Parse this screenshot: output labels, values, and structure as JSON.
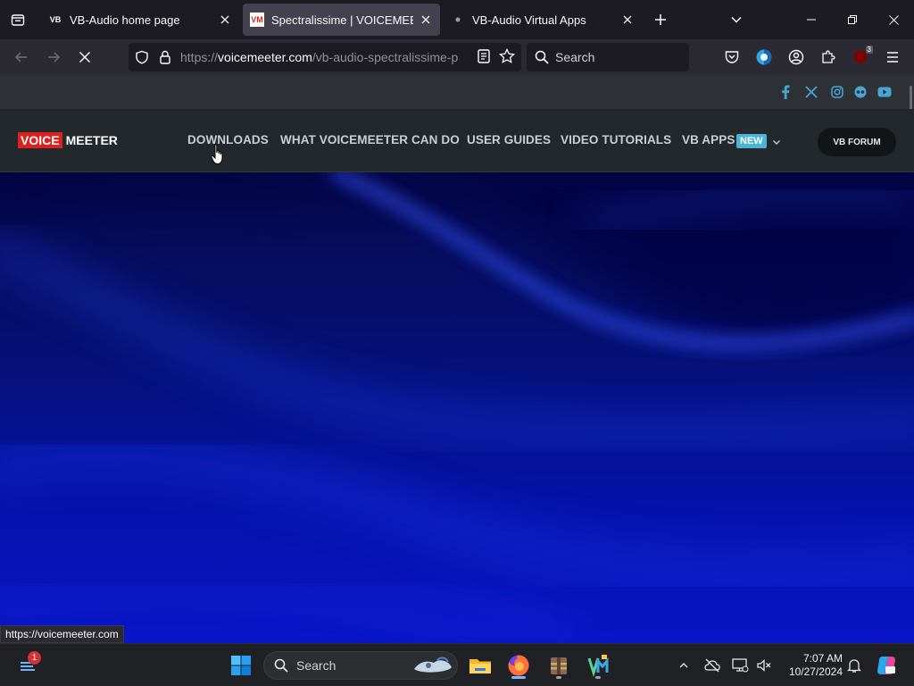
{
  "browser": {
    "tabs": [
      {
        "title": "VB-Audio home page",
        "favicon": "vb-logo-icon",
        "favicon_text": "VB",
        "active": false
      },
      {
        "title": "Spectralissime | VOICEMEETER",
        "favicon": "vm-logo-icon",
        "favicon_text": "VM",
        "active": true
      },
      {
        "title": "VB-Audio Virtual Apps",
        "favicon": "loading-dot-icon",
        "active": false
      }
    ],
    "url_scheme": "https://",
    "url_host": "voicemeeter.com",
    "url_path": "/vb-audio-spectralissime-p",
    "search_placeholder": "Search",
    "extension_badge": "3"
  },
  "site": {
    "logo_part1": "VOICE",
    "logo_part2": "MEETER",
    "nav": [
      "DOWNLOADS",
      "WHAT VOICEMEETER CAN DO",
      "USER GUIDES",
      "VIDEO TUTORIALS",
      "VB APPS"
    ],
    "new_badge": "NEW",
    "forum_button": "VB FORUM",
    "social": [
      "facebook-icon",
      "x-icon",
      "instagram-icon",
      "flickr-icon",
      "youtube-icon"
    ],
    "colors": {
      "logo_red": "#d8231f",
      "new_badge": "#48b4d6",
      "hero_blue": "#0a17c8"
    }
  },
  "status_bar": {
    "text": "https://voicemeeter.com"
  },
  "taskbar": {
    "search_placeholder": "Search",
    "widgets_badge": "1",
    "time": "7:07 AM",
    "date": "10/27/2024"
  }
}
